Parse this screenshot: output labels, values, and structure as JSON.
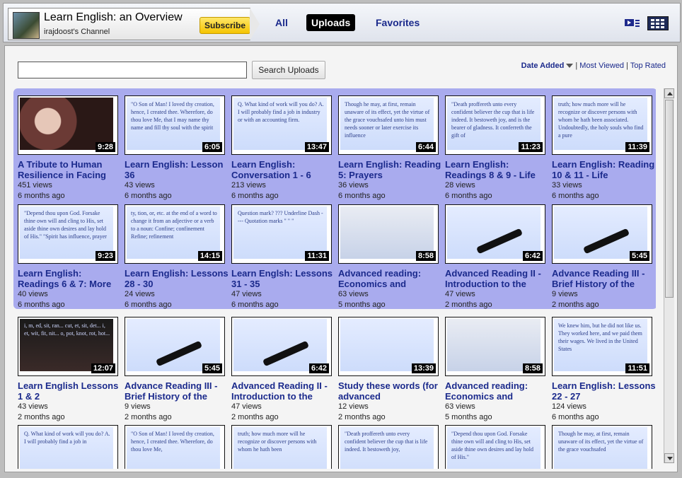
{
  "header": {
    "channel_title": "Learn English: an Overview",
    "channel_subtitle": "irajdoost's Channel",
    "subscribe_label": "Subscribe",
    "tabs": [
      {
        "label": "All",
        "active": false
      },
      {
        "label": "Uploads",
        "active": true
      },
      {
        "label": "Favorites",
        "active": false
      }
    ],
    "view_icons": [
      "player-view-icon",
      "grid-view-icon"
    ]
  },
  "search": {
    "placeholder": "",
    "value": "",
    "button_label": "Search Uploads"
  },
  "sort": {
    "selected": "Date Added",
    "options": [
      "Most Viewed",
      "Top Rated"
    ],
    "separator": "|"
  },
  "videos": [
    {
      "title": "A Tribute to Human Resilience in Facing",
      "views": "451 views",
      "age": "6 months ago",
      "duration": "9:28",
      "thumb": "person",
      "thumb_text": ""
    },
    {
      "title": "Learn English: Lesson 36",
      "views": "43 views",
      "age": "6 months ago",
      "duration": "6:05",
      "thumb": "blue",
      "thumb_text": "\"O Son of Man! I loved thy creation, hence, I created thee. Wherefore, do thou love Me, that I may name thy name and fill thy soul with the spirit"
    },
    {
      "title": "Learn English: Conversation 1 - 6",
      "views": "213 views",
      "age": "6 months ago",
      "duration": "13:47",
      "thumb": "blue",
      "thumb_text": "Q. What kind of work will you do? A. I will probably find a job in industry or with an accounting firm."
    },
    {
      "title": "Learn English: Reading 5: Prayers",
      "views": "36 views",
      "age": "6 months ago",
      "duration": "6:44",
      "thumb": "blue",
      "thumb_text": "Though he may, at first, remain unaware of its effect, yet the virtue of the grace vouchsafed unto him must needs sooner or later exercise its influence"
    },
    {
      "title": "Learn English: Readings 8 & 9 - Life",
      "views": "28 views",
      "age": "6 months ago",
      "duration": "11:23",
      "thumb": "blue",
      "thumb_text": "\"Death proffereth unto every confident believer the cup that is life indeed. It bestoweth joy, and is the bearer of gladness. It conferreth the gift of"
    },
    {
      "title": "Learn English: Reading 10 & 11 - Life",
      "views": "33 views",
      "age": "6 months ago",
      "duration": "11:39",
      "thumb": "blue",
      "thumb_text": "truth; how much more will he recognize or discover persons with whom he hath been associated. Undoubtedly, the holy souls who find a pure"
    },
    {
      "title": "Learn English: Readings 6 & 7: More",
      "views": "40 views",
      "age": "6 months ago",
      "duration": "9:23",
      "thumb": "blue",
      "thumb_text": "\"Depend thou upon God. Forsake thine own will and cling to His, set aside thine own desires and lay hold of His.\" \"Spirit has influence, prayer"
    },
    {
      "title": "Learn English: Lessons 28 - 30",
      "views": "24 views",
      "age": "6 months ago",
      "duration": "14:15",
      "thumb": "blue",
      "thumb_text": "ty, tion, or, etc. at the end of a word to change it from an adjective or a verb to a noun: Confine; confinement Refine; refinement"
    },
    {
      "title": "Learn Englsh: Lessons 31 - 35",
      "views": "47 views",
      "age": "6 months ago",
      "duration": "11:31",
      "thumb": "blue",
      "thumb_text": "Question mark? ??? Underline Dash ---- Quotation marks \" \" \""
    },
    {
      "title": "Advanced reading: Economics and",
      "views": "63 views",
      "age": "5 months ago",
      "duration": "8:58",
      "thumb": "gray",
      "thumb_text": ""
    },
    {
      "title": "Advanced Reading II - Introduction to the",
      "views": "47 views",
      "age": "2 months ago",
      "duration": "6:42",
      "thumb": "pen",
      "thumb_text": ""
    },
    {
      "title": "Advance Reading III - Brief History of the",
      "views": "9 views",
      "age": "2 months ago",
      "duration": "5:45",
      "thumb": "pen",
      "thumb_text": ""
    },
    {
      "title": "Learn English Lessons 1 & 2",
      "views": "43 views",
      "age": "2 months ago",
      "duration": "12:07",
      "thumb": "dark",
      "thumb_text": "i, m, ed, sit, ran... cut, et, sit, det... i, et, wit, fit, nit... o, pot, knot, rot, hot..."
    },
    {
      "title": "Advance Reading III - Brief History of the",
      "views": "9 views",
      "age": "2 months ago",
      "duration": "5:45",
      "thumb": "pen",
      "thumb_text": ""
    },
    {
      "title": "Advanced Reading II - Introduction to the",
      "views": "47 views",
      "age": "2 months ago",
      "duration": "6:42",
      "thumb": "pen",
      "thumb_text": ""
    },
    {
      "title": "Study these words (for advanced",
      "views": "12 views",
      "age": "2 months ago",
      "duration": "13:39",
      "thumb": "blue",
      "thumb_text": ""
    },
    {
      "title": "Advanced reading: Economics and",
      "views": "63 views",
      "age": "5 months ago",
      "duration": "8:58",
      "thumb": "gray",
      "thumb_text": ""
    },
    {
      "title": "Learn English: Lessons 22 - 27",
      "views": "124 views",
      "age": "6 months ago",
      "duration": "11:51",
      "thumb": "blue",
      "thumb_text": "We knew him, but he did not like us. They worked here, and we paid them their wages. We lived in the United States"
    },
    {
      "title": "",
      "views": "",
      "age": "",
      "duration": "",
      "thumb": "blue",
      "thumb_text": "Q. What kind of work will you do? A. I will probably find a job in"
    },
    {
      "title": "",
      "views": "",
      "age": "",
      "duration": "",
      "thumb": "blue",
      "thumb_text": "\"O Son of Man! I loved thy creation, hence, I created thee. Wherefore, do thou love Me,"
    },
    {
      "title": "",
      "views": "",
      "age": "",
      "duration": "",
      "thumb": "blue",
      "thumb_text": "truth; how much more will he recognize or discover persons with whom he hath been"
    },
    {
      "title": "",
      "views": "",
      "age": "",
      "duration": "",
      "thumb": "blue",
      "thumb_text": "\"Death proffereth unto every confident believer the cup that is life indeed. It bestoweth joy,"
    },
    {
      "title": "",
      "views": "",
      "age": "",
      "duration": "",
      "thumb": "blue",
      "thumb_text": "\"Depend thou upon God. Forsake thine own will and cling to His, set aside thine own desires and lay hold of His.\""
    },
    {
      "title": "",
      "views": "",
      "age": "",
      "duration": "",
      "thumb": "blue",
      "thumb_text": "Though he may, at first, remain unaware of its effect, yet the virtue of the grace vouchsafed"
    }
  ]
}
